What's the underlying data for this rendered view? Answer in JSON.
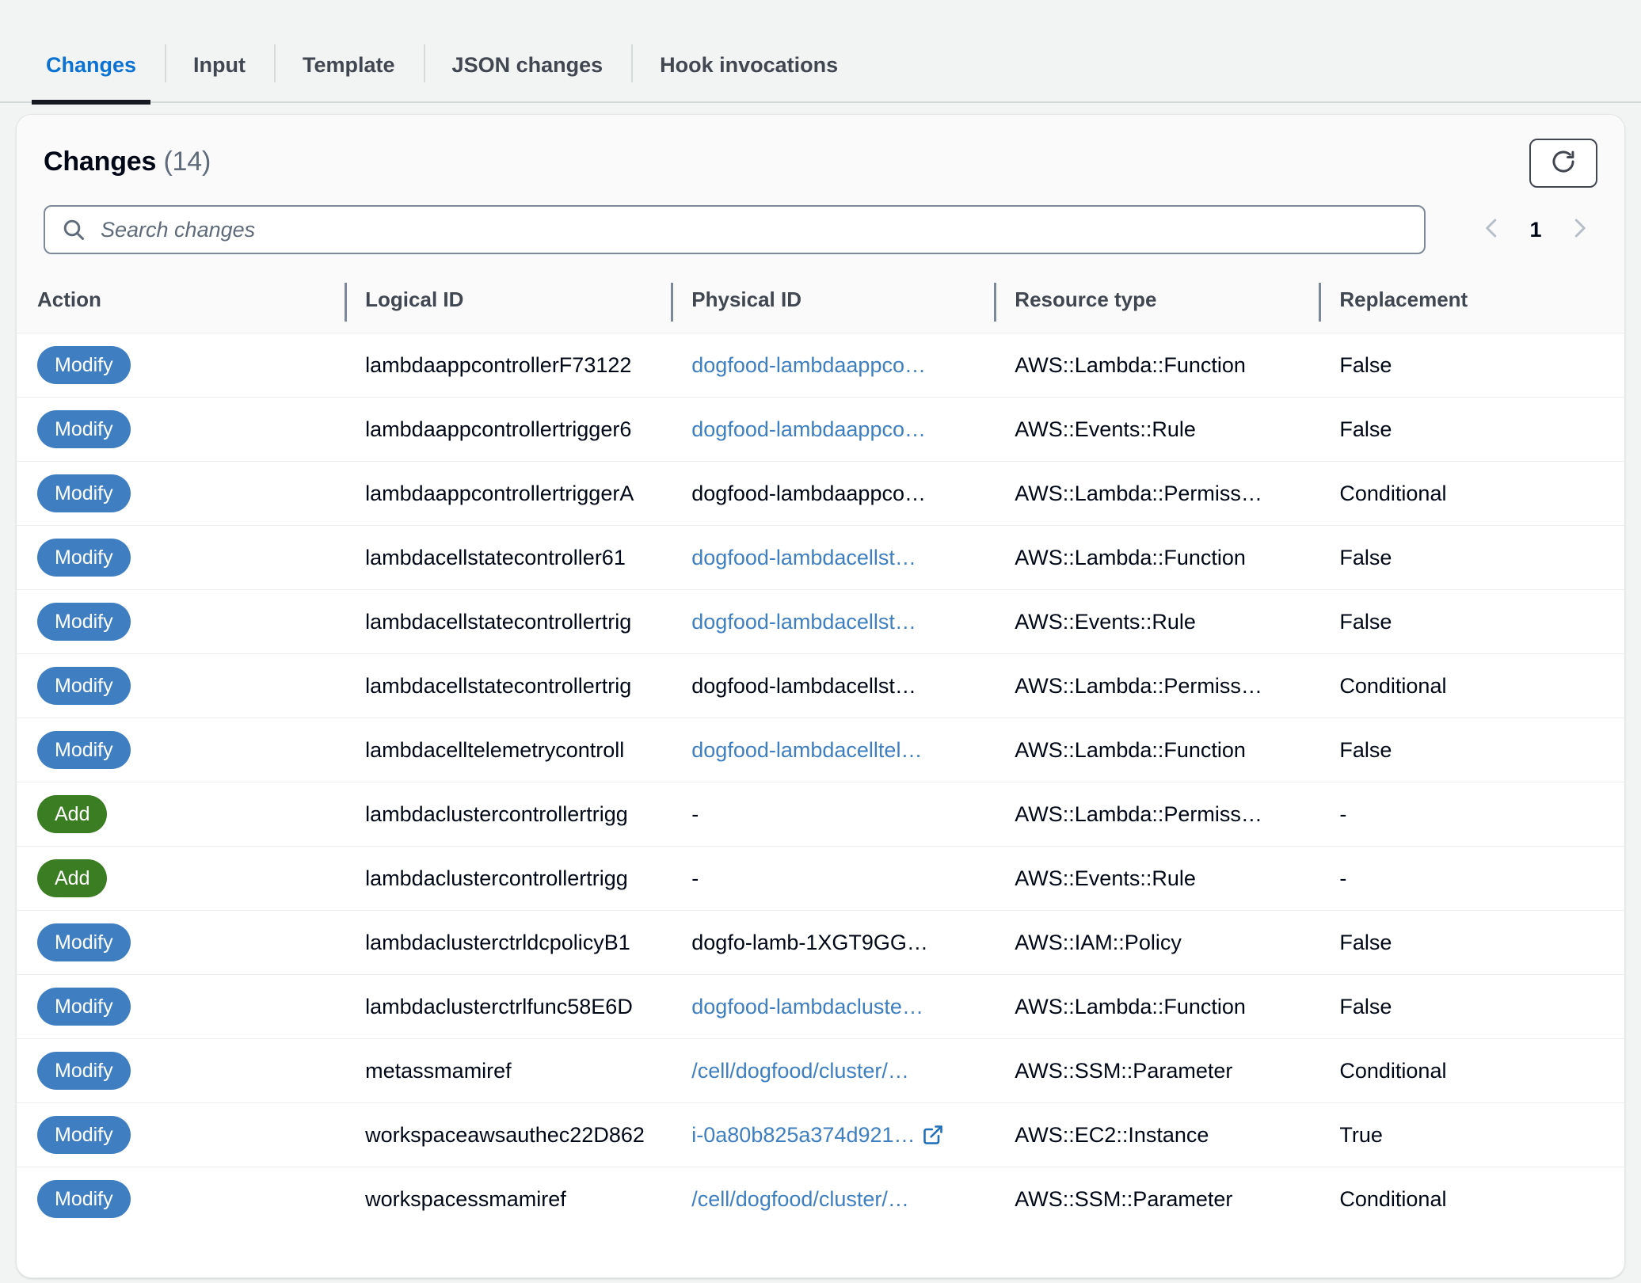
{
  "tabs": [
    {
      "label": "Changes",
      "active": true
    },
    {
      "label": "Input",
      "active": false
    },
    {
      "label": "Template",
      "active": false
    },
    {
      "label": "JSON changes",
      "active": false
    },
    {
      "label": "Hook invocations",
      "active": false
    }
  ],
  "panel": {
    "title": "Changes",
    "count": "(14)",
    "refresh_icon": "refresh-icon"
  },
  "search": {
    "placeholder": "Search changes",
    "value": "",
    "icon": "search-icon"
  },
  "pagination": {
    "prev_icon": "chevron-left-icon",
    "next_icon": "chevron-right-icon",
    "current_page": "1"
  },
  "table": {
    "columns": [
      {
        "label": "Action"
      },
      {
        "label": "Logical ID"
      },
      {
        "label": "Physical ID"
      },
      {
        "label": "Resource type"
      },
      {
        "label": "Replacement"
      }
    ],
    "rows": [
      {
        "action": "Modify",
        "action_type": "modify",
        "logical_id": "lambdaappcontrollerF73122",
        "physical_id": "dogfood-lambdaappco…",
        "physical_is_link": true,
        "physical_external": false,
        "resource_type": "AWS::Lambda::Function",
        "replacement": "False"
      },
      {
        "action": "Modify",
        "action_type": "modify",
        "logical_id": "lambdaappcontrollertrigger6",
        "physical_id": "dogfood-lambdaappco…",
        "physical_is_link": true,
        "physical_external": false,
        "resource_type": "AWS::Events::Rule",
        "replacement": "False"
      },
      {
        "action": "Modify",
        "action_type": "modify",
        "logical_id": "lambdaappcontrollertriggerA",
        "physical_id": "dogfood-lambdaappco…",
        "physical_is_link": false,
        "physical_external": false,
        "resource_type": "AWS::Lambda::Permiss…",
        "replacement": "Conditional"
      },
      {
        "action": "Modify",
        "action_type": "modify",
        "logical_id": "lambdacellstatecontroller61",
        "physical_id": "dogfood-lambdacellst…",
        "physical_is_link": true,
        "physical_external": false,
        "resource_type": "AWS::Lambda::Function",
        "replacement": "False"
      },
      {
        "action": "Modify",
        "action_type": "modify",
        "logical_id": "lambdacellstatecontrollertrig",
        "physical_id": "dogfood-lambdacellst…",
        "physical_is_link": true,
        "physical_external": false,
        "resource_type": "AWS::Events::Rule",
        "replacement": "False"
      },
      {
        "action": "Modify",
        "action_type": "modify",
        "logical_id": "lambdacellstatecontrollertrig",
        "physical_id": "dogfood-lambdacellst…",
        "physical_is_link": false,
        "physical_external": false,
        "resource_type": "AWS::Lambda::Permiss…",
        "replacement": "Conditional"
      },
      {
        "action": "Modify",
        "action_type": "modify",
        "logical_id": "lambdacelltelemetrycontroll",
        "physical_id": "dogfood-lambdacelltel…",
        "physical_is_link": true,
        "physical_external": false,
        "resource_type": "AWS::Lambda::Function",
        "replacement": "False"
      },
      {
        "action": "Add",
        "action_type": "add",
        "logical_id": "lambdaclustercontrollertrigg",
        "physical_id": "-",
        "physical_is_link": false,
        "physical_external": false,
        "resource_type": "AWS::Lambda::Permiss…",
        "replacement": "-"
      },
      {
        "action": "Add",
        "action_type": "add",
        "logical_id": "lambdaclustercontrollertrigg",
        "physical_id": "-",
        "physical_is_link": false,
        "physical_external": false,
        "resource_type": "AWS::Events::Rule",
        "replacement": "-"
      },
      {
        "action": "Modify",
        "action_type": "modify",
        "logical_id": "lambdaclusterctrldcpolicyB1",
        "physical_id": "dogfo-lamb-1XGT9GG…",
        "physical_is_link": false,
        "physical_external": false,
        "resource_type": "AWS::IAM::Policy",
        "replacement": "False"
      },
      {
        "action": "Modify",
        "action_type": "modify",
        "logical_id": "lambdaclusterctrlfunc58E6D",
        "physical_id": "dogfood-lambdacluste…",
        "physical_is_link": true,
        "physical_external": false,
        "resource_type": "AWS::Lambda::Function",
        "replacement": "False"
      },
      {
        "action": "Modify",
        "action_type": "modify",
        "logical_id": "metassmamiref",
        "physical_id": "/cell/dogfood/cluster/…",
        "physical_is_link": true,
        "physical_external": false,
        "resource_type": "AWS::SSM::Parameter",
        "replacement": "Conditional"
      },
      {
        "action": "Modify",
        "action_type": "modify",
        "logical_id": "workspaceawsauthec22D862",
        "physical_id": "i-0a80b825a374d921…",
        "physical_is_link": true,
        "physical_external": true,
        "resource_type": "AWS::EC2::Instance",
        "replacement": "True"
      },
      {
        "action": "Modify",
        "action_type": "modify",
        "logical_id": "workspacessmamiref",
        "physical_id": "/cell/dogfood/cluster/…",
        "physical_is_link": true,
        "physical_external": false,
        "resource_type": "AWS::SSM::Parameter",
        "replacement": "Conditional"
      }
    ]
  },
  "colors": {
    "link": "#3d7fc0",
    "modify_badge": "#3f7fc1",
    "add_badge": "#3b7d22",
    "active_tab": "#0972d3"
  }
}
